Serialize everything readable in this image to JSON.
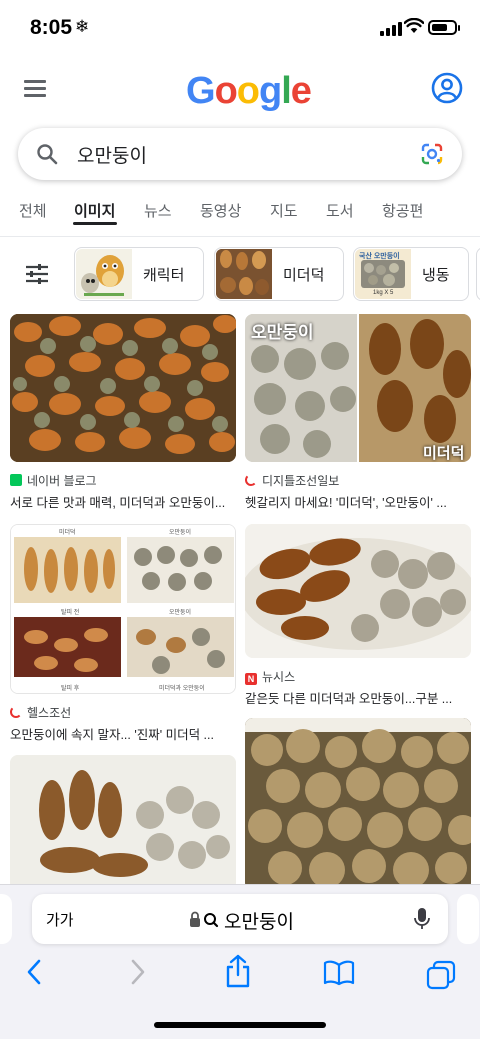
{
  "status_bar": {
    "time": "8:05",
    "time_icon": "snowflake-icon"
  },
  "header": {
    "logo": [
      "G",
      "o",
      "o",
      "g",
      "l",
      "e"
    ]
  },
  "search": {
    "query": "오만둥이"
  },
  "tabs": [
    "전체",
    "이미지",
    "뉴스",
    "동영상",
    "지도",
    "도서",
    "항공편"
  ],
  "active_tab": "이미지",
  "chips": [
    {
      "label": "캐릭터"
    },
    {
      "label": "미더덕"
    },
    {
      "label": "냉동",
      "thumb_text": "국산 오만둥이",
      "thumb_sub": "1kg X 5"
    }
  ],
  "results": [
    {
      "source": "네이버 블로그",
      "caption": "서로 다른 맛과 매력, 미더덕과 오만둥이...",
      "fav_color": "#03C75A"
    },
    {
      "source": "디지틀조선일보",
      "caption": "헷갈리지 마세요! '미더덕', '오만둥이' ...",
      "fav_color": "#E8302E",
      "overlay_left": "오만둥이",
      "overlay_right": "미더덕"
    },
    {
      "source": "헬스조선",
      "caption": "오만둥이에 속지 말자... '진짜' 미더덕 ...",
      "fav_color": "#E8302E",
      "grid_labels": [
        "미더덕",
        "오만둥이",
        "탈피 전",
        "오만둥이",
        "탈피 후",
        "미더덕과 오만둥이"
      ]
    },
    {
      "source": "뉴시스",
      "caption": "같은듯 다른 미더덕과 오만둥이...구분 ...",
      "fav_color": "#E8302E",
      "fav_letter": "N"
    },
    {
      "source": "",
      "caption": ""
    },
    {
      "source": "",
      "caption": ""
    }
  ],
  "address_bar": {
    "text_size": "가가",
    "url": "오만둥이"
  },
  "toolbar": [
    "back-icon",
    "forward-icon",
    "share-icon",
    "bookmarks-icon",
    "tabs-icon"
  ]
}
